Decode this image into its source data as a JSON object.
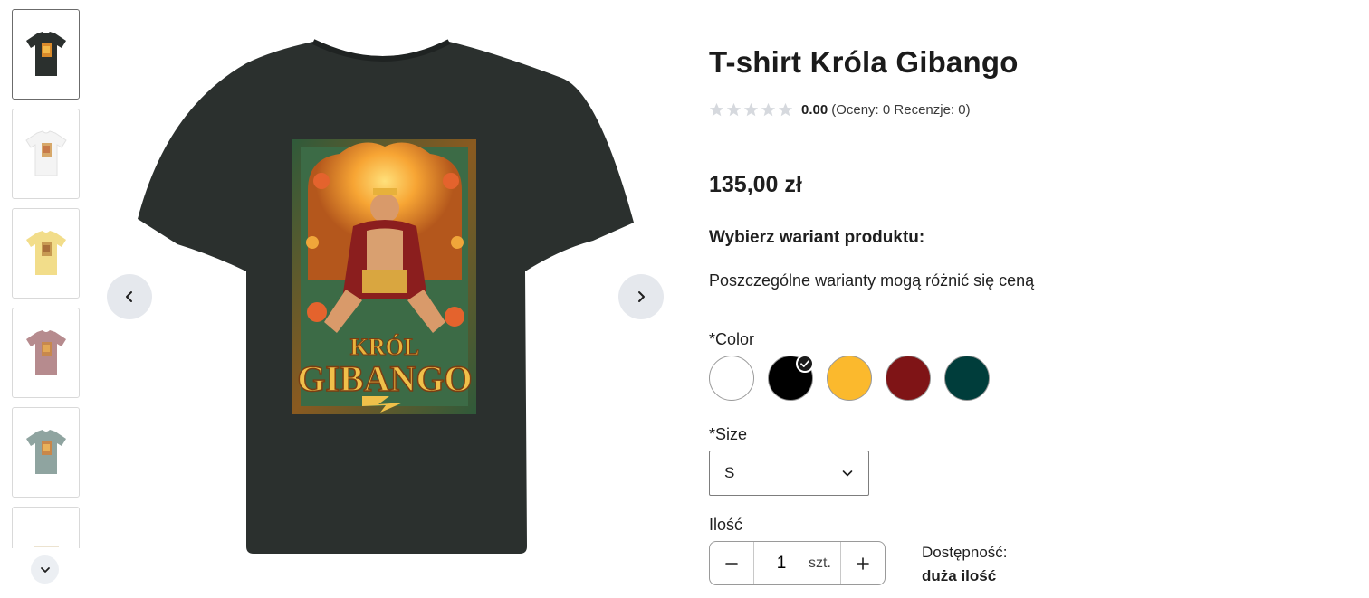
{
  "product": {
    "title": "T-shirt Króla Gibango",
    "rating": {
      "value": "0.00",
      "meta": "(Oceny: 0 Recenzje: 0)",
      "stars_filled": 0,
      "stars_total": 5
    },
    "price": "135,00 zł",
    "variant_title": "Wybierz wariant produktu:",
    "variant_note": "Poszczególne warianty mogą różnić się ceną"
  },
  "gallery": {
    "thumbnails": [
      {
        "shirt_color": "#2b302e",
        "active": true
      },
      {
        "shirt_color": "#f4f4f4",
        "active": false
      },
      {
        "shirt_color": "#f2dd8a",
        "active": false
      },
      {
        "shirt_color": "#b68b8e",
        "active": false
      },
      {
        "shirt_color": "#8fa4a0",
        "active": false
      },
      {
        "shirt_color": "#ffffff",
        "active": false
      }
    ],
    "main_shirt_color": "#2b302e",
    "print_text_top": "KRÓL",
    "print_text_bottom": "GIBANGO"
  },
  "color_option": {
    "label": "*Color",
    "swatches": [
      {
        "name": "white",
        "hex": "#ffffff",
        "selected": false
      },
      {
        "name": "black",
        "hex": "#000000",
        "selected": true
      },
      {
        "name": "yellow",
        "hex": "#fbb92d",
        "selected": false
      },
      {
        "name": "burgundy",
        "hex": "#7f1416",
        "selected": false
      },
      {
        "name": "dark-green",
        "hex": "#003d3b",
        "selected": false
      }
    ]
  },
  "size_option": {
    "label": "*Size",
    "value": "S"
  },
  "quantity": {
    "label": "Ilość",
    "value": "1",
    "unit": "szt."
  },
  "availability": {
    "label": "Dostępność:",
    "value": "duża ilość"
  },
  "icons": {
    "prev": "chevron-left-icon",
    "next": "chevron-right-icon",
    "thumbs_down": "chevron-down-icon",
    "select": "chevron-down-icon",
    "minus": "minus-icon",
    "plus": "plus-icon",
    "check": "check-icon",
    "star": "star-icon"
  }
}
